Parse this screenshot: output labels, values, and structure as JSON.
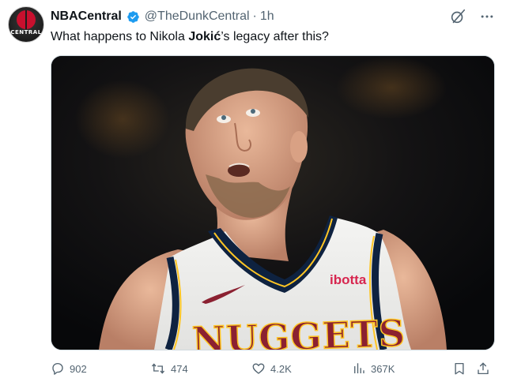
{
  "author": {
    "display_name": "NBACentral",
    "handle": "@TheDunkCentral",
    "separator": "·",
    "time": "1h",
    "avatar_text": "CENTRAL"
  },
  "tweet": {
    "text_before": "What happens to Nikola ",
    "text_bold": "Jokić",
    "text_after": "’s legacy after this?"
  },
  "media": {
    "jersey_text": "NUGGETS",
    "sponsor_text": "ibotta"
  },
  "actions": {
    "replies": "902",
    "reposts": "474",
    "likes": "4.2K",
    "views": "367K"
  },
  "icons": {
    "top": [
      "grok-icon",
      "more-icon"
    ],
    "actions": [
      "reply-icon",
      "repost-icon",
      "like-icon",
      "views-icon",
      "bookmark-icon",
      "share-icon"
    ]
  },
  "colors": {
    "verified_blue": "#1d9bf0",
    "secondary_text": "#536471",
    "jersey_navy": "#0e2240",
    "jersey_red": "#8b2131",
    "jersey_gold": "#fec524"
  }
}
